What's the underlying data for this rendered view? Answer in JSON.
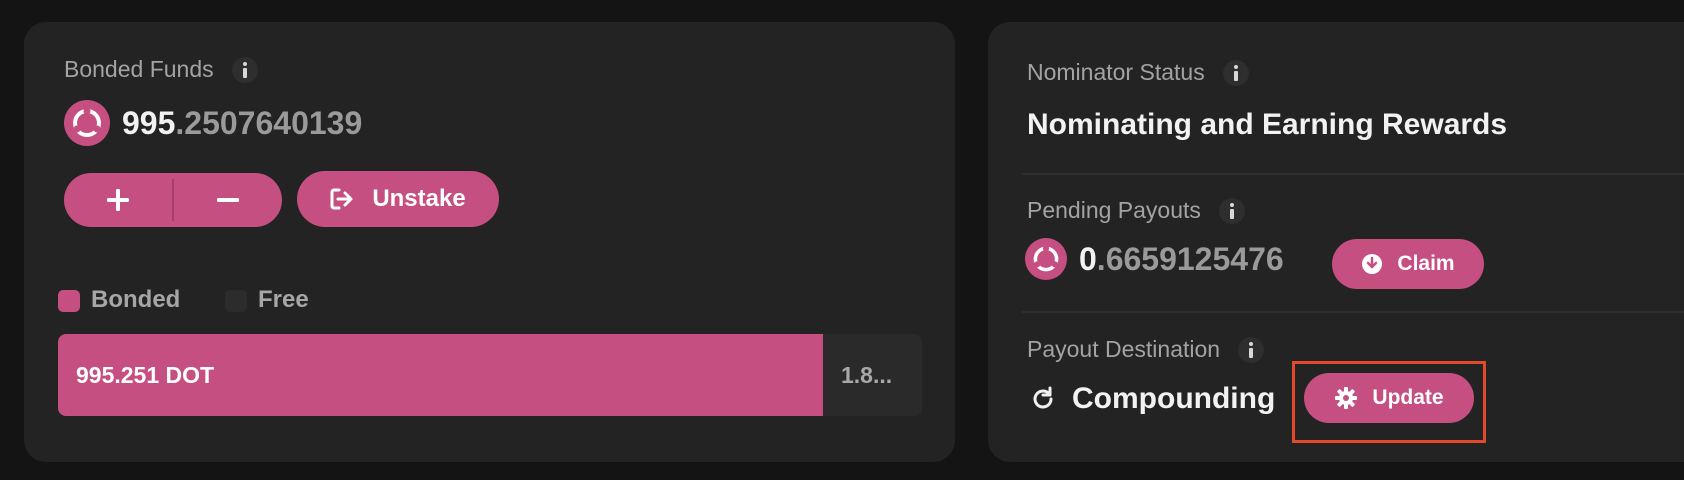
{
  "bonded_card": {
    "title": "Bonded Funds",
    "amount_int": "995",
    "amount_dec": ".2507640139",
    "unstake_label": "Unstake",
    "legend": {
      "bonded": "Bonded",
      "free": "Free"
    },
    "bar": {
      "bonded_label": "995.251 DOT",
      "free_label": "1.8...",
      "bonded_fraction": 0.885
    }
  },
  "status_card": {
    "nominator_title": "Nominator Status",
    "nominator_status": "Nominating and Earning Rewards",
    "payouts_title": "Pending Payouts",
    "payouts_int": "0",
    "payouts_dec": ".6659125476",
    "claim_label": "Claim",
    "destination_title": "Payout Destination",
    "destination_value": "Compounding",
    "update_label": "Update"
  },
  "colors": {
    "accent": "#c64f82",
    "highlight": "#e24a2b"
  }
}
